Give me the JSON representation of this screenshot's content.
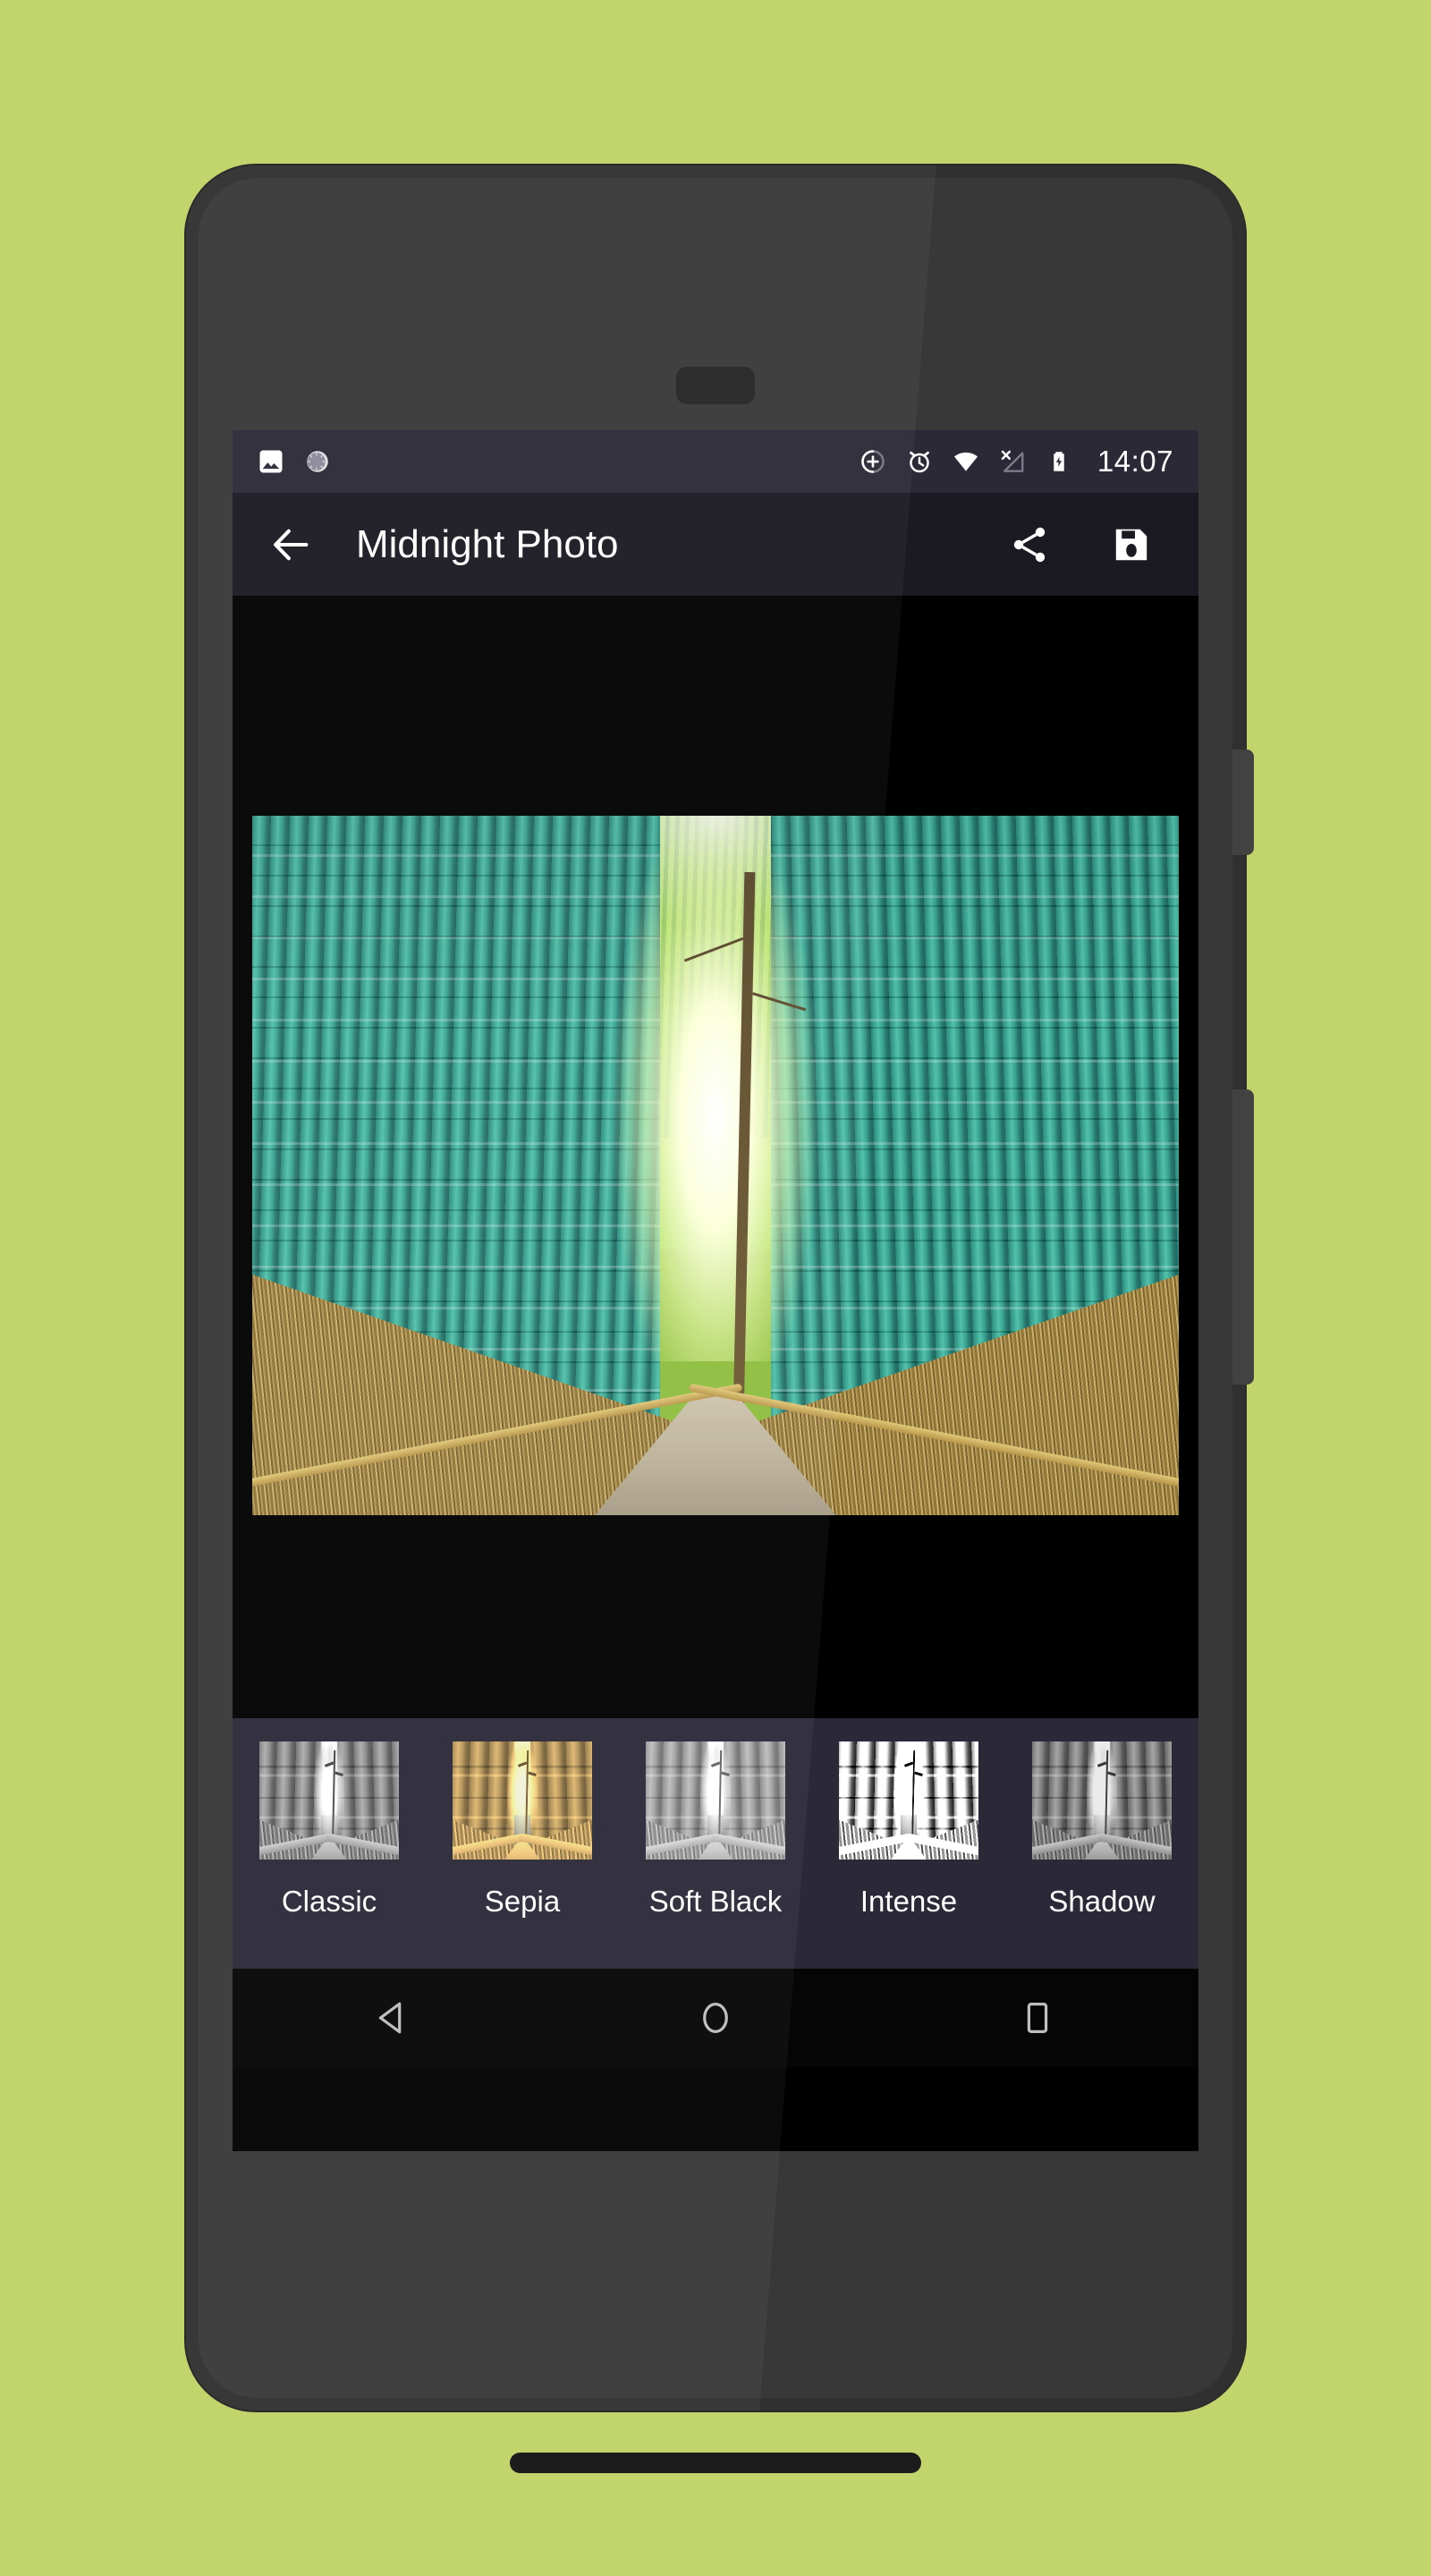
{
  "theme": {
    "page_background": "#c2d56c",
    "phone_body": "#303030",
    "status_bar_bg": "#2b2936",
    "app_bar_bg": "#1b1a22",
    "filter_strip_bg": "#2b2938",
    "nav_bar_bg": "#050505",
    "text_primary": "#ffffff"
  },
  "status_bar": {
    "left_icons": [
      {
        "name": "photo-icon",
        "label": "Photo"
      },
      {
        "name": "sync-spinner-icon",
        "label": "Syncing"
      }
    ],
    "right_icons": [
      {
        "name": "add-circle-icon",
        "label": "Add"
      },
      {
        "name": "alarm-clock-icon",
        "label": "Alarm"
      },
      {
        "name": "wifi-icon",
        "label": "Wi-Fi"
      },
      {
        "name": "no-signal-icon",
        "label": "No signal"
      },
      {
        "name": "battery-charging-icon",
        "label": "Charging"
      }
    ],
    "clock": "14:07"
  },
  "app_bar": {
    "back_label": "Back",
    "title": "Midnight Photo",
    "share_label": "Share",
    "save_label": "Save"
  },
  "photo_canvas": {
    "image_alt": "Bamboo forest path",
    "letterbox_color": "#000000"
  },
  "filters": {
    "items": [
      {
        "id": "classic",
        "label": "Classic"
      },
      {
        "id": "sepia",
        "label": "Sepia"
      },
      {
        "id": "softblack",
        "label": "Soft Black"
      },
      {
        "id": "intense",
        "label": "Intense"
      },
      {
        "id": "shadow",
        "label": "Shadow"
      }
    ]
  },
  "nav_bar": {
    "back": "Back",
    "home": "Home",
    "recents": "Recents"
  }
}
